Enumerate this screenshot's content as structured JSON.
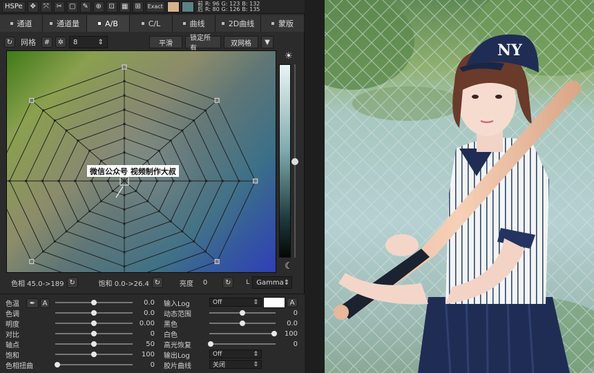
{
  "toolbar": {
    "mode": "HSPe",
    "exact_label": "Exact",
    "readout": {
      "row1": [
        "前",
        "R: 96",
        "G: 123",
        "B: 132"
      ],
      "row2": [
        "后",
        "R: 80",
        "G: 126",
        "B: 135"
      ]
    },
    "colors": {
      "before": "#d7b28c",
      "after": "#5b8189"
    }
  },
  "tabs": [
    {
      "label": "通道"
    },
    {
      "label": "通道量"
    },
    {
      "label": "A/B",
      "active": true
    },
    {
      "label": "C/L"
    },
    {
      "label": "曲线"
    },
    {
      "label": "2D曲线"
    },
    {
      "label": "蒙版"
    }
  ],
  "options": {
    "grid_label": "网格",
    "divisions": "8",
    "smooth_label": "平滑",
    "lock_all_label": "锁定所有",
    "double_grid_label": "双网格"
  },
  "wheel": {
    "watermark": "微信公众号 视频制作大叔"
  },
  "status": {
    "hue": "色相 45.0->189",
    "saturation": "饱和 0.0->26.4",
    "brightness_label": "亮度",
    "brightness_value": "0",
    "l_label": "L",
    "gamma": "Gamma"
  },
  "sliders_left": [
    {
      "label": "色温",
      "value": "0.0"
    },
    {
      "label": "色调",
      "value": "0.0"
    },
    {
      "label": "明度",
      "value": "0.00"
    },
    {
      "label": "对比",
      "value": "0"
    },
    {
      "label": "轴点",
      "value": "50"
    },
    {
      "label": "饱和",
      "value": "100"
    },
    {
      "label": "色相扭曲",
      "value": "0"
    }
  ],
  "sliders_right": [
    {
      "label": "输入Log",
      "select": "Off"
    },
    {
      "label": "动态范围",
      "value": "0"
    },
    {
      "label": "黑色",
      "value": "0.0"
    },
    {
      "label": "白色",
      "value": "100"
    },
    {
      "label": "高光恢复",
      "value": "0"
    },
    {
      "label": "输出Log",
      "select": "Off"
    },
    {
      "label": "胶片曲线",
      "select": "关闭"
    }
  ],
  "a_label": "A"
}
